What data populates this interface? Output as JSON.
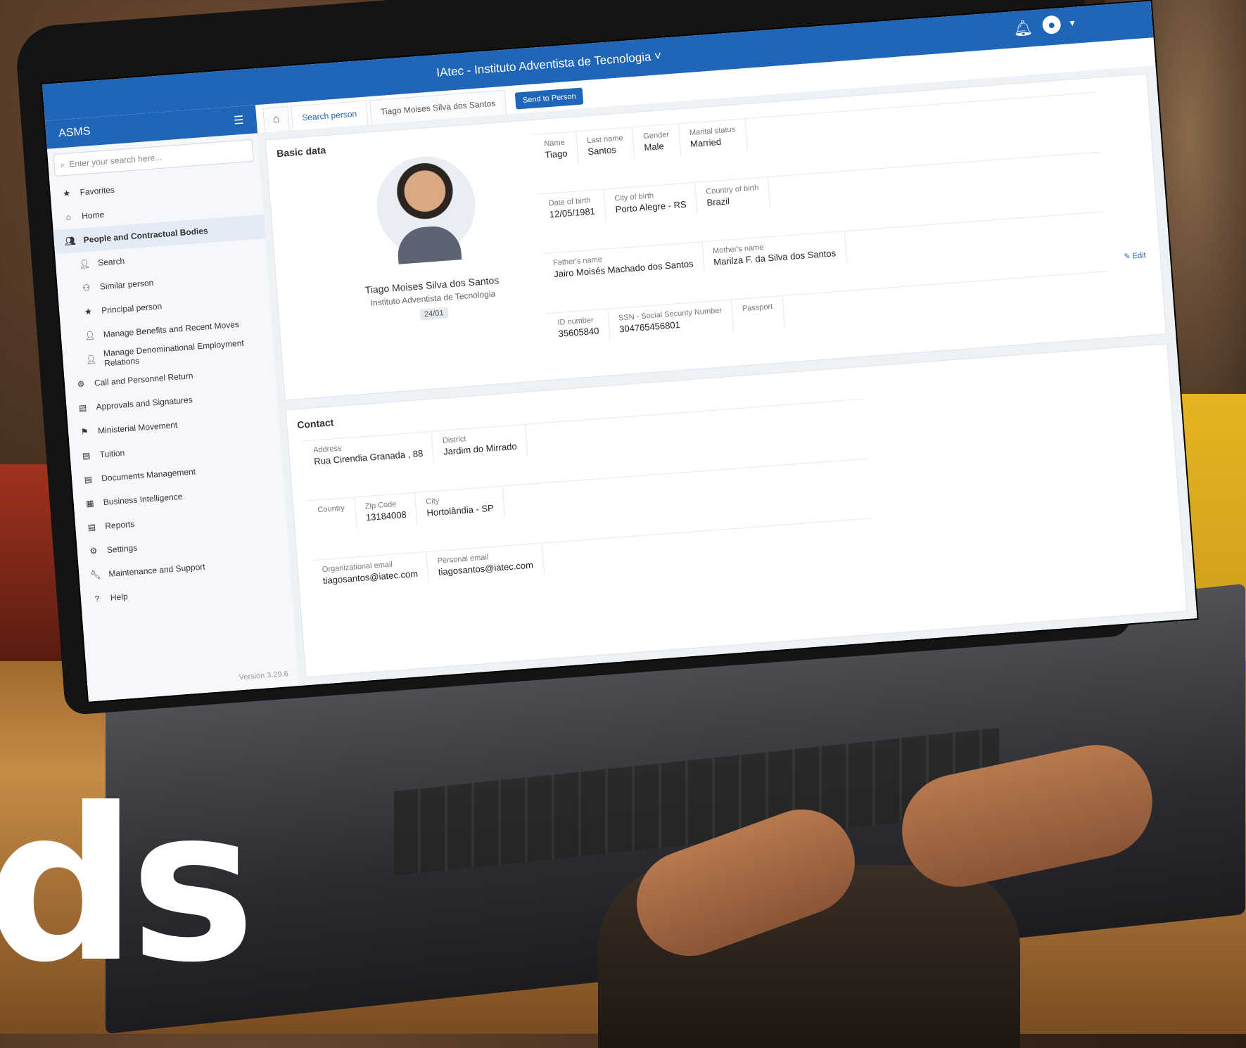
{
  "app": {
    "title": "IAtec - Instituto Adventista de Tecnologia ˅",
    "logo": "ASMS",
    "search_placeholder": "Enter your search here...",
    "version": "Version 3.29.6"
  },
  "menu": [
    {
      "label": "Favorites",
      "icon": "star"
    },
    {
      "label": "Home",
      "icon": "home"
    },
    {
      "label": "People and Contractual Bodies",
      "icon": "people",
      "active": true
    },
    {
      "label": "Search",
      "icon": "person",
      "sub": true
    },
    {
      "label": "Similar person",
      "icon": "users",
      "sub": true
    },
    {
      "label": "Principal person",
      "icon": "star",
      "sub": true
    },
    {
      "label": "Manage Benefits and Recent Moves",
      "icon": "person",
      "sub": true
    },
    {
      "label": "Manage Denominational Employment Relations",
      "icon": "person",
      "sub": true
    },
    {
      "label": "Call and Personnel Return",
      "icon": "gear"
    },
    {
      "label": "Approvals and Signatures",
      "icon": "doc"
    },
    {
      "label": "Ministerial Movement",
      "icon": "flag"
    },
    {
      "label": "Tuition",
      "icon": "doc"
    },
    {
      "label": "Documents Management",
      "icon": "doc"
    },
    {
      "label": "Business Intelligence",
      "icon": "chart"
    },
    {
      "label": "Reports",
      "icon": "doc"
    },
    {
      "label": "Settings",
      "icon": "gear"
    },
    {
      "label": "Maintenance and Support",
      "icon": "wrench"
    },
    {
      "label": "Help",
      "icon": "question"
    }
  ],
  "tabs": {
    "home": "⌂",
    "items": [
      "Search person",
      "Tiago Moises Silva dos Santos"
    ],
    "action": "Send to Person"
  },
  "profile": {
    "section_title": "Basic data",
    "name": "Tiago Moises Silva dos Santos",
    "org": "Instituto Adventista de Tecnologia",
    "badge": "24/01"
  },
  "basic_rows": [
    [
      {
        "label": "Name",
        "value": "Tiago"
      },
      {
        "label": "Last name",
        "value": "Santos"
      },
      {
        "label": "Gender",
        "value": "Male"
      },
      {
        "label": "Marital status",
        "value": "Married"
      }
    ],
    [
      {
        "label": "Date of birth",
        "value": "12/05/1981"
      },
      {
        "label": "City of birth",
        "value": "Porto Alegre - RS"
      },
      {
        "label": "Country of birth",
        "value": "Brazil"
      }
    ],
    [
      {
        "label": "Father's name",
        "value": "Jairo Moisés Machado dos Santos"
      },
      {
        "label": "Mother's name",
        "value": "Marilza F. da Silva dos Santos"
      }
    ],
    [
      {
        "label": "ID number",
        "value": "35605840"
      },
      {
        "label": "SSN - Social Security Number",
        "value": "304765456801"
      },
      {
        "label": "Passport",
        "value": ""
      }
    ]
  ],
  "edit_label": "✎ Edit",
  "contact": {
    "title": "Contact",
    "rows": [
      [
        {
          "label": "Address",
          "value": "Rua Cirendia Granada , 88"
        },
        {
          "label": "District",
          "value": "Jardim do Mirrado"
        }
      ],
      [
        {
          "label": "Country",
          "value": ""
        },
        {
          "label": "Zip Code",
          "value": "13184008"
        },
        {
          "label": "City",
          "value": "Hortolândia - SP"
        }
      ],
      [
        {
          "label": "Organizational email",
          "value": "tiagosantos@iatec.com"
        },
        {
          "label": "Personal email",
          "value": "tiagosantos@iatec.com"
        }
      ]
    ]
  },
  "headline": "ds"
}
